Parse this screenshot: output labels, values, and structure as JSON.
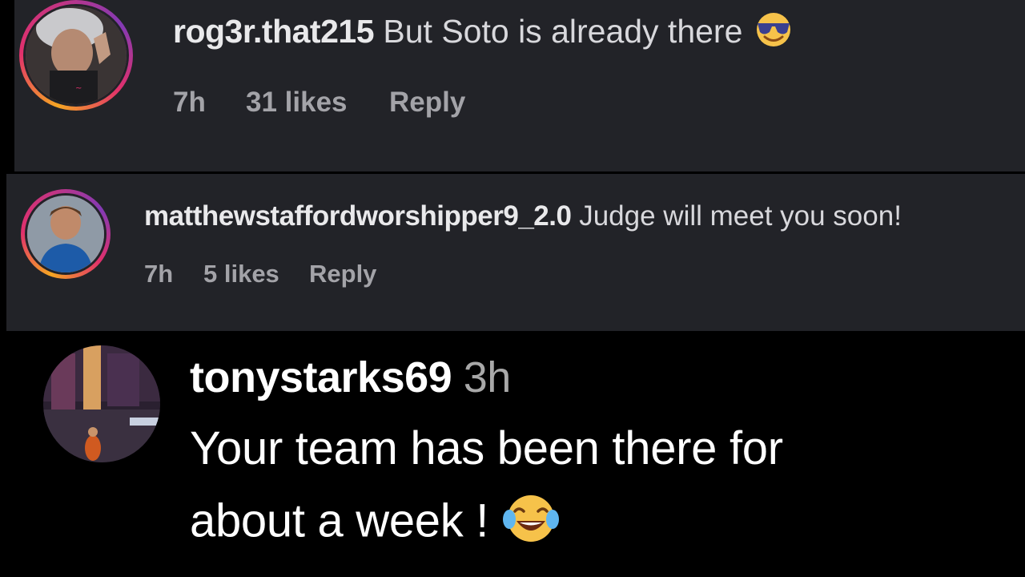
{
  "comments": [
    {
      "username": "rog3r.that215",
      "text": "But Soto is already there",
      "emoji": "smiling-face-with-sunglasses",
      "time": "7h",
      "likes": "31 likes",
      "reply_label": "Reply"
    },
    {
      "username": "matthewstaffordworshipper9_2.0",
      "text": "Judge will meet you soon!",
      "time": "7h",
      "likes": "5 likes",
      "reply_label": "Reply"
    },
    {
      "username": "tonystarks69",
      "time": "3h",
      "text_line1": "Your team has been there for",
      "text_line2": "about a week !",
      "emoji": "face-with-tears-of-joy"
    }
  ],
  "colors": {
    "panel_bg": "#222328",
    "page_bg": "#000000",
    "meta_text": "#a3a3a8",
    "story_ring": "#e1306c"
  }
}
